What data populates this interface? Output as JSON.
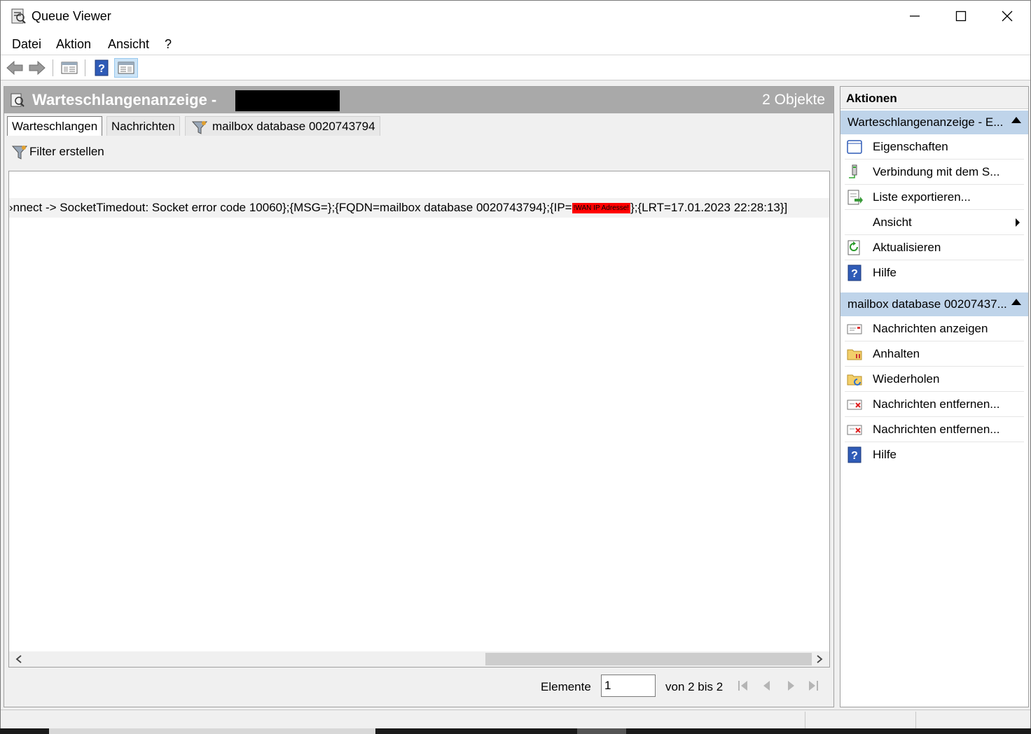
{
  "window": {
    "title": "Queue Viewer",
    "min_glyph": "—",
    "max_glyph": "☐",
    "close_glyph": "✕"
  },
  "menu": {
    "datei": "Datei",
    "aktion": "Aktion",
    "ansicht": "Ansicht",
    "help": "?"
  },
  "main": {
    "title": "Warteschlangenanzeige -",
    "count": "2 Objekte",
    "tabs": {
      "queues": "Warteschlangen",
      "messages": "Nachrichten",
      "filter": "mailbox database 0020743794"
    },
    "filter_button": "Filter erstellen",
    "row": {
      "text_before": "›nnect -> SocketTimedout: Socket error code 10060};{MSG=};{FQDN=mailbox database 0020743794};{IP=",
      "redacted_label": "!WAN IP Adresse!",
      "text_after": "};{LRT=17.01.2023 22:28:13}]"
    },
    "pager": {
      "elements_label": "Elemente",
      "page_value": "1",
      "range_label": "von 2 bis 2"
    }
  },
  "actions": {
    "title": "Aktionen",
    "section1": {
      "title": "Warteschlangenanzeige - E...",
      "items": [
        {
          "label": "Eigenschaften",
          "icon": "properties-icon"
        },
        {
          "label": "Verbindung mit dem S...",
          "icon": "connect-server-icon"
        },
        {
          "label": "Liste exportieren...",
          "icon": "export-list-icon"
        },
        {
          "label": "Ansicht",
          "icon": ""
        },
        {
          "label": "Aktualisieren",
          "icon": "refresh-icon"
        },
        {
          "label": "Hilfe",
          "icon": "help-icon"
        }
      ]
    },
    "section2": {
      "title": "mailbox database 00207437...",
      "items": [
        {
          "label": "Nachrichten anzeigen",
          "icon": "view-messages-icon"
        },
        {
          "label": "Anhalten",
          "icon": "suspend-folder-icon"
        },
        {
          "label": "Wiederholen",
          "icon": "retry-folder-icon"
        },
        {
          "label": "Nachrichten entfernen...",
          "icon": "remove-messages-icon"
        },
        {
          "label": "Nachrichten entfernen...",
          "icon": "remove-messages-icon"
        },
        {
          "label": "Hilfe",
          "icon": "help-icon"
        }
      ]
    }
  },
  "colors": {
    "header_bg": "#a9a9a9",
    "section_bg": "#bfd4ea",
    "redact_red": "#ff0000"
  }
}
